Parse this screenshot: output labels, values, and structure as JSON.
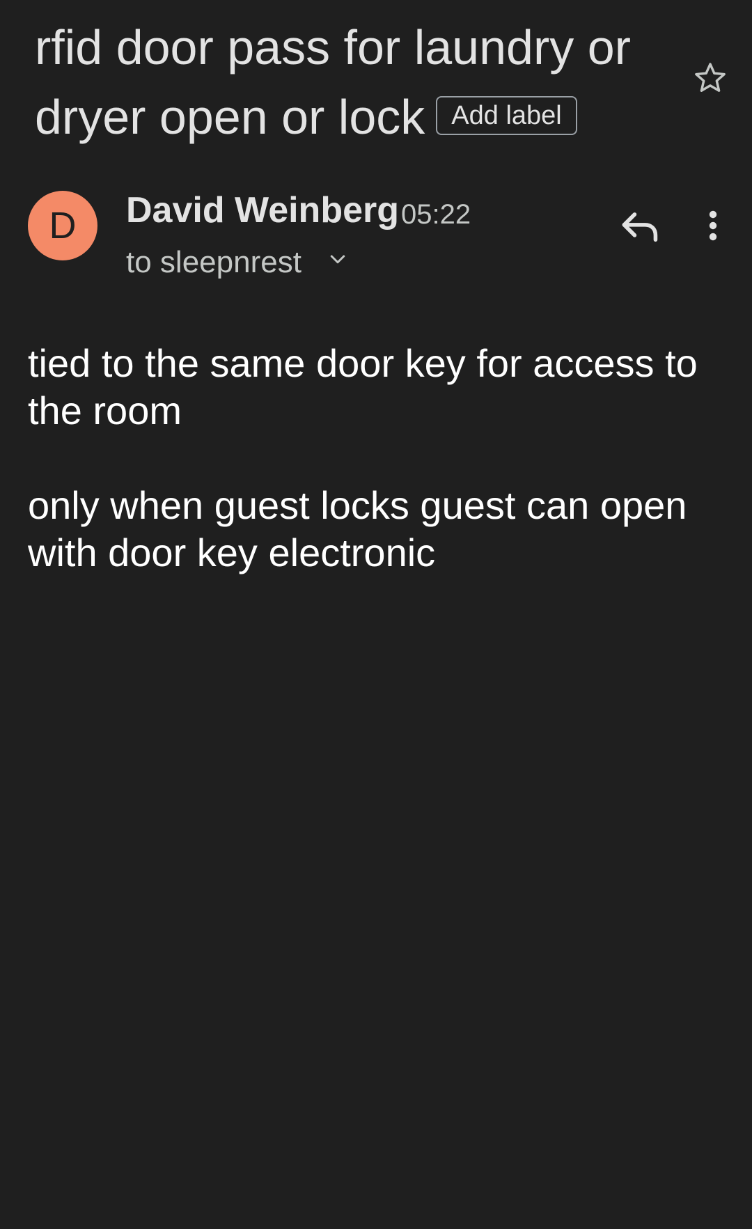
{
  "email": {
    "subject_line1": "rfid door pass for laundry or",
    "subject_line2": "dryer open or lock",
    "add_label": "Add label",
    "sender": {
      "initial": "D",
      "name": "David Weinberg",
      "time": "05:22",
      "recipient": "to sleepnrest"
    },
    "body": [
      "tied to the same door key for access to the room",
      "only when guest locks guest can open with door key electronic"
    ]
  },
  "icons": {
    "star": "star-outline-icon",
    "chevron": "chevron-down-icon",
    "reply": "reply-icon",
    "more": "more-vertical-icon"
  },
  "colors": {
    "background": "#1f1f1f",
    "avatar": "#f48a67",
    "text_primary": "#e3e3e3",
    "text_secondary": "#c4c7c5"
  }
}
